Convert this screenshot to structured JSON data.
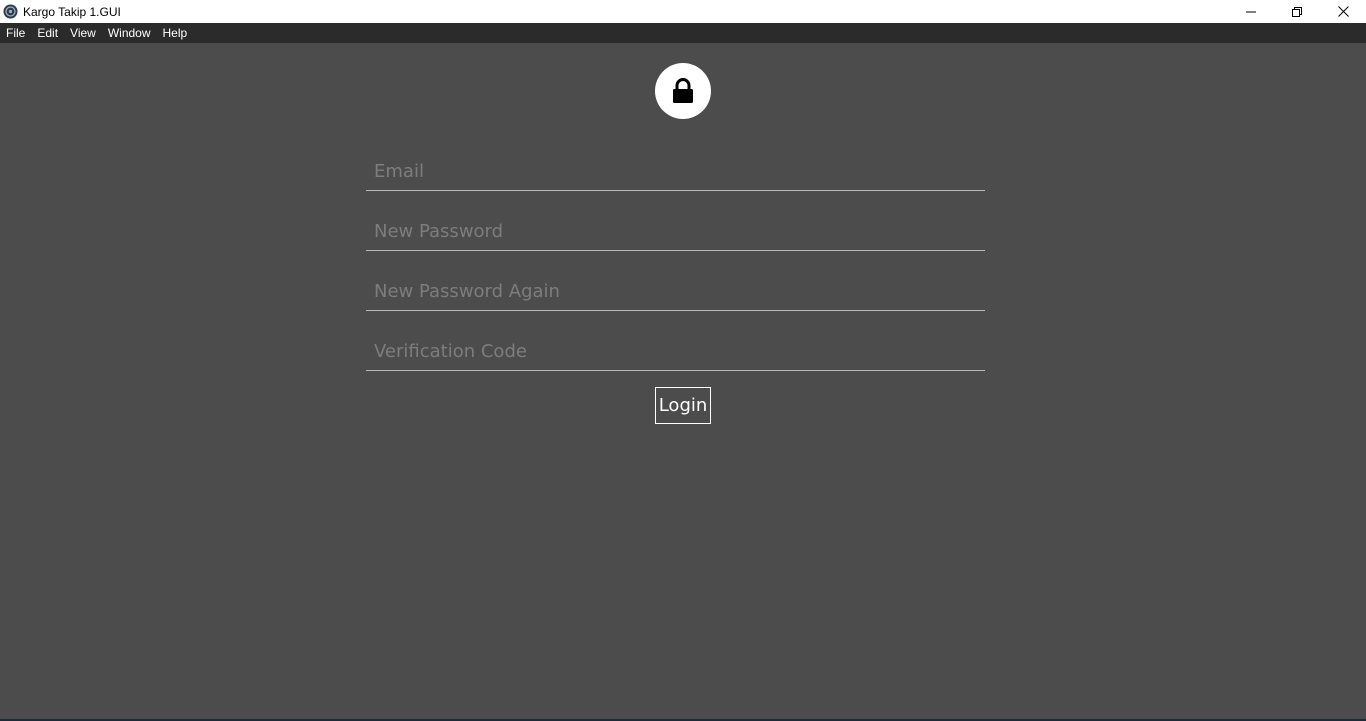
{
  "window": {
    "title": "Kargo Takip 1.GUI",
    "icon": "app-logo-icon",
    "controls": [
      "minimize-icon",
      "restore-icon",
      "close-icon"
    ]
  },
  "menu": {
    "items": [
      "File",
      "Edit",
      "View",
      "Window",
      "Help"
    ]
  },
  "form": {
    "icon": "lock-icon",
    "fields": {
      "email": {
        "placeholder": "Email",
        "value": ""
      },
      "new_password": {
        "placeholder": "New Password",
        "value": ""
      },
      "new_password_again": {
        "placeholder": "New Password Again",
        "value": ""
      },
      "verification_code": {
        "placeholder": "Verification Code",
        "value": ""
      }
    },
    "submit_label": "Login"
  },
  "colors": {
    "background": "#4c4c4c",
    "menubar": "#2b2b2b",
    "titlebar": "#ffffff",
    "placeholder": "#7d7d7d",
    "underline": "#b9b9b9"
  }
}
